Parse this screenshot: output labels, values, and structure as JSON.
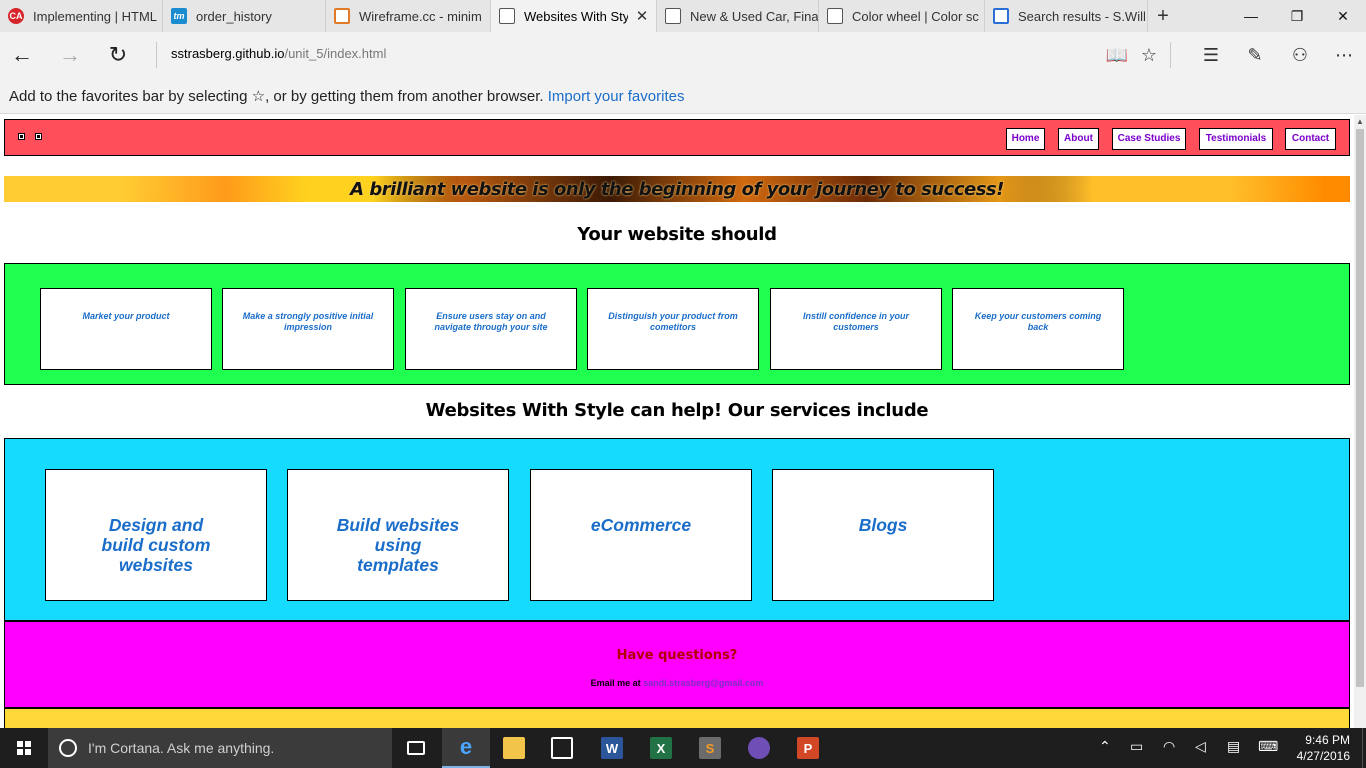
{
  "browser": {
    "tabs": [
      {
        "title": "Implementing | HTML",
        "favicon": "red-circle-icon"
      },
      {
        "title": "order_history",
        "favicon": "tm-icon"
      },
      {
        "title": "Wireframe.cc - minim",
        "favicon": "wireframe-icon"
      },
      {
        "title": "Websites With Sty",
        "favicon": "page-icon",
        "active": true
      },
      {
        "title": "New & Used Car, Fina",
        "favicon": "document-icon"
      },
      {
        "title": "Color wheel | Color sc",
        "favicon": "page-icon"
      },
      {
        "title": "Search results - S.Will",
        "favicon": "search-results-icon"
      }
    ],
    "new_tab": "+",
    "window_controls": {
      "minimize": "—",
      "maximize": "❐",
      "close": "✕"
    },
    "url": {
      "host": "sstrasberg.github.io",
      "path": "/unit_5/index.html"
    },
    "nav": {
      "back": "←",
      "forward": "→",
      "refresh": "↻"
    },
    "toolbar": {
      "reading_view": "📖",
      "favorite": "☆",
      "hub": "☰",
      "note": "✎",
      "share": "⚇",
      "more": "⋯"
    },
    "favorites_hint": {
      "text": "Add to the favorites bar by selecting ☆, or by getting them from another browser.",
      "link": "Import your favorites"
    }
  },
  "site": {
    "nav": [
      "Home",
      "About",
      "Case Studies",
      "Testimonials",
      "Contact"
    ],
    "banner": "A brilliant website is only the beginning of your journey to success!",
    "heading1": "Your website should",
    "benefits": [
      "Market your product",
      "Make a strongly positive initial impression",
      "Ensure users stay on and navigate through your site",
      "Distinguish your product from cometitors",
      "Instill confidence in your customers",
      "Keep your customers coming back"
    ],
    "heading2": "Websites With Style can help! Our services include",
    "services": [
      "Design and build custom websites",
      "Build websites using templates",
      "eCommerce",
      "Blogs"
    ],
    "contact": {
      "question": "Have questions?",
      "email_label": "Email me at",
      "email": "sandi.strasberg@gmail.com"
    },
    "colors": {
      "header": "#ff4f5a",
      "benefits": "#1fff4f",
      "services": "#15dcff",
      "contact": "#ff00ff",
      "footer": "#ffd83a",
      "nav_text": "#7b00cc",
      "card_text": "#1a6dc9"
    }
  },
  "taskbar": {
    "search_placeholder": "I'm Cortana. Ask me anything.",
    "apps": [
      "task-view-icon",
      "edge-icon",
      "file-explorer-icon",
      "store-icon",
      "word-icon",
      "excel-icon",
      "sublime-icon",
      "app-icon",
      "powerpoint-icon"
    ],
    "time": "9:46 PM",
    "date": "4/27/2016"
  }
}
